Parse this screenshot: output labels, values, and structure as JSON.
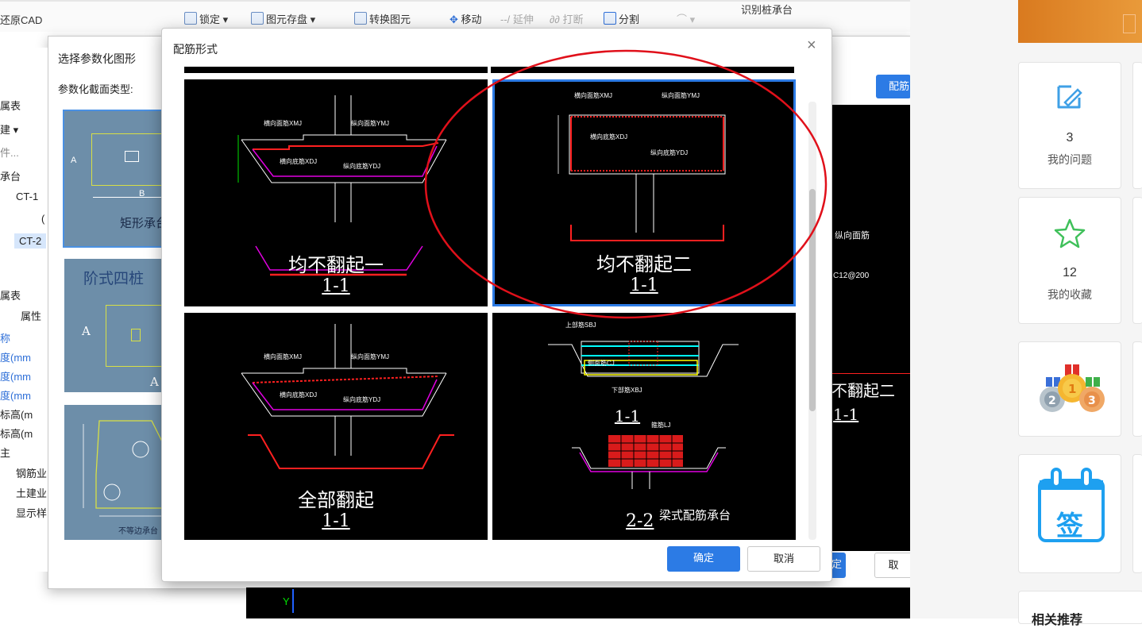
{
  "toolbar": {
    "items": [
      {
        "label": "还原CAD"
      },
      {
        "label": "锁定 ▾"
      },
      {
        "label": "图元存盘 ▾"
      },
      {
        "label": "转换图元"
      },
      {
        "label": "移动"
      },
      {
        "label": "延伸"
      },
      {
        "label": "打断"
      },
      {
        "label": "分割"
      },
      {
        "label": "识别桩承台"
      }
    ]
  },
  "left_panel": {
    "items": [
      "属表",
      "建 ▾",
      "件...",
      "承台",
      "CT-1",
      "(",
      "CT-2",
      "属表",
      "属性",
      "称",
      "度(mm",
      "度(mm",
      "度(mm",
      "标高(m",
      "标高(m",
      "主",
      "钢筋业",
      "土建业",
      "显示样"
    ]
  },
  "outer_dialog": {
    "title": "选择参数化图形",
    "section_label": "参数化截面类型:",
    "thumbnails": [
      "矩形承台",
      "阶式四桩",
      "不等边承台"
    ],
    "cad_labels": [
      "不翻起二",
      "1-1"
    ],
    "top_button": "配筋",
    "ok_label": "确定",
    "cancel_label": "取"
  },
  "dialog": {
    "title": "配筋形式",
    "close_icon": "close-icon",
    "ok_label": "确定",
    "cancel_label": "取消",
    "options": [
      {
        "title": "均不翻起一",
        "section": "1-1",
        "selected": false
      },
      {
        "title": "均不翻起二",
        "section": "1-1",
        "selected": true
      },
      {
        "title": "全部翻起",
        "section": "1-1",
        "selected": false
      },
      {
        "title": "梁式配筋承台",
        "section": "2-2",
        "section_top": "1-1",
        "selected": false
      }
    ]
  },
  "cad_texts": {
    "horiz_top": "横向面筋XMJ",
    "long_top": "纵向面筋YMJ",
    "horiz_bottom": "横向底筋XDJ",
    "long_bottom": "纵向底筋YDJ",
    "top_rebar": "上部筋SBJ",
    "side_rebar": "侧面筋CJ",
    "bottom_rebar": "下部筋XBJ",
    "stirrup": "箍筋LJ",
    "cad_value": "C12@200"
  },
  "right_sidebar": {
    "cards": [
      {
        "count": "3",
        "label": "我的问题",
        "icon": "edit-icon"
      },
      {
        "count": "12",
        "label": "我的收藏",
        "icon": "star-icon"
      },
      {
        "count": "",
        "label": "",
        "icon": "medals-icon"
      },
      {
        "count": "",
        "label": "签",
        "icon": "calendar-sign-icon"
      }
    ],
    "bottom_title": "相关推荐"
  },
  "colors": {
    "accent": "#2c7be5",
    "annotation_red": "#e0101a",
    "cad_bg": "#000000",
    "cad_green": "#00e000",
    "cad_magenta": "#e000e0",
    "cad_red": "#ff2020",
    "sign_blue": "#1ea0f0"
  }
}
